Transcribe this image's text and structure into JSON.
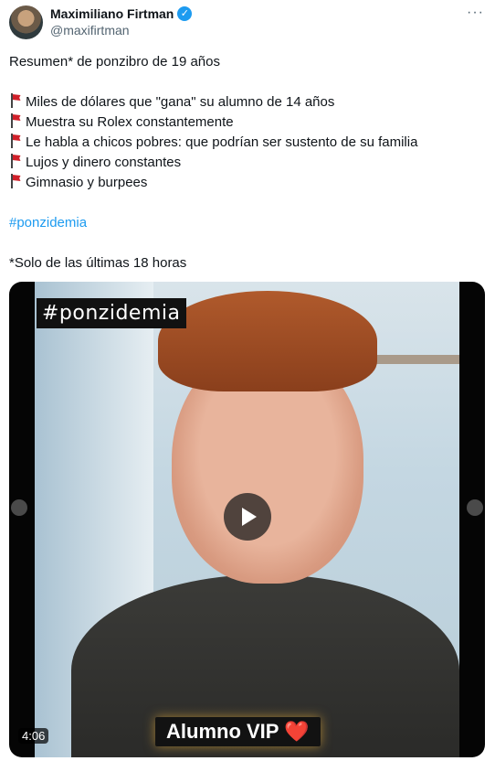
{
  "tweet": {
    "author_name": "Maximiliano Firtman",
    "author_handle": "@maxifirtman",
    "more_label": "···",
    "text": {
      "intro": "Resumen* de ponzibro de 19 años",
      "points": [
        "Miles de dólares que \"gana\" su alumno de 14 años",
        "Muestra su Rolex constantemente",
        "Le habla a chicos pobres: que podrían ser sustento de su familia",
        "Lujos y dinero constantes",
        "Gimnasio y burpees"
      ],
      "hashtag": "#ponzidemia",
      "footnote": "*Solo de las últimas 18 horas"
    },
    "video": {
      "overlay_tag": "#ponzidemia",
      "duration": "4:06",
      "caption": "Alumno VIP",
      "caption_emoji": "❤️"
    }
  }
}
